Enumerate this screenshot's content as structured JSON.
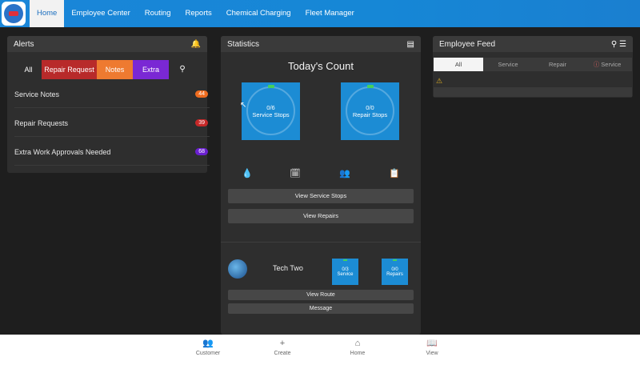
{
  "nav": {
    "items": [
      {
        "label": "Home",
        "active": true
      },
      {
        "label": "Employee Center"
      },
      {
        "label": "Routing"
      },
      {
        "label": "Reports"
      },
      {
        "label": "Chemical Charging"
      },
      {
        "label": "Fleet Manager"
      }
    ]
  },
  "alerts": {
    "title": "Alerts",
    "filters": {
      "all": "All",
      "repair": "Repair Request",
      "notes": "Notes",
      "extra": "Extra"
    },
    "rows": [
      {
        "label": "Service Notes",
        "count": "44",
        "color": "#ef6c1f"
      },
      {
        "label": "Repair Requests",
        "count": "39",
        "color": "#c62828"
      },
      {
        "label": "Extra Work Approvals Needed",
        "count": "68",
        "color": "#6a1fd0"
      }
    ]
  },
  "stats": {
    "title": "Statistics",
    "heading": "Today's Count",
    "service_tile": {
      "count": "0/6",
      "label": "Service Stops"
    },
    "repair_tile": {
      "count": "0/0",
      "label": "Repair Stops"
    },
    "btn_view_service": "View Service Stops",
    "btn_view_repairs": "View Repairs",
    "tech": {
      "name": "Tech Two",
      "service": {
        "count": "0/3",
        "label": "Service"
      },
      "repairs": {
        "count": "0/0",
        "label": "Repairs"
      },
      "btn_route": "View Route",
      "btn_message": "Message"
    }
  },
  "feed": {
    "title": "Employee Feed",
    "tabs": [
      "All",
      "Service",
      "Repair",
      "Service"
    ]
  },
  "bottom": {
    "items": [
      {
        "label": "Customer",
        "icon": "people-icon"
      },
      {
        "label": "Create",
        "icon": "plus-icon"
      },
      {
        "label": "Home",
        "icon": "home-icon"
      },
      {
        "label": "View",
        "icon": "book-icon"
      }
    ]
  }
}
